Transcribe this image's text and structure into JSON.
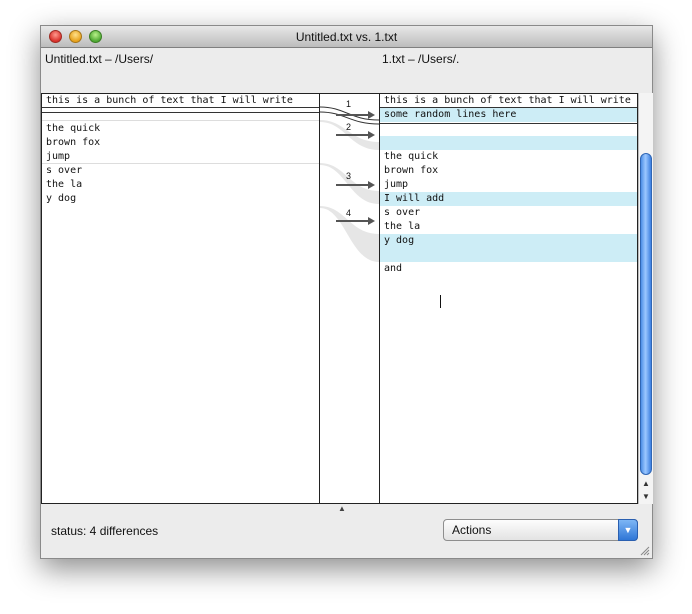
{
  "window": {
    "title": "Untitled.txt vs. 1.txt"
  },
  "left_pane": {
    "path": "Untitled.txt – /Users/",
    "lines": [
      "this is a bunch of text that I will write",
      "",
      "the quick",
      "brown fox",
      "jump",
      "s over",
      "the la",
      "y dog"
    ]
  },
  "right_pane": {
    "path": "1.txt – /Users/.",
    "lines": [
      "this is a bunch of text that I will write",
      "some random lines here",
      "",
      "",
      "the quick",
      "brown fox",
      "jump",
      "I will add",
      "s over",
      "the la",
      "y dog",
      "",
      "and"
    ]
  },
  "differences": [
    "1",
    "2",
    "3",
    "4"
  ],
  "footer": {
    "status": "status:  4 differences",
    "actions_label": "Actions"
  },
  "colors": {
    "highlight": "#cdedf6",
    "scroll_thumb": "#4d8fe6",
    "popup_arrow": "#2f76d6"
  }
}
